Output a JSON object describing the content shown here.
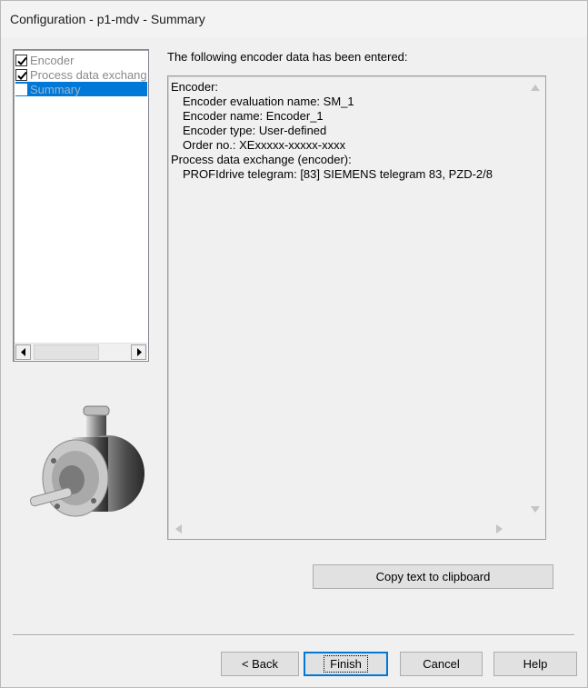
{
  "window": {
    "title": "Configuration - p1-mdv - Summary"
  },
  "tree": {
    "items": [
      {
        "label": "Encoder",
        "checked": true
      },
      {
        "label": "Process data exchange",
        "checked": true
      },
      {
        "label": "Summary",
        "checked": false,
        "selected": true
      }
    ]
  },
  "main": {
    "intro": "The following encoder data has been entered:",
    "summary_lines": [
      {
        "text": "Encoder:",
        "indent": 0
      },
      {
        "text": "Encoder evaluation name: SM_1",
        "indent": 1
      },
      {
        "text": "Encoder name: Encoder_1",
        "indent": 1
      },
      {
        "text": "Encoder type: User-defined",
        "indent": 1
      },
      {
        "text": "Order no.: XExxxxx-xxxxx-xxxx",
        "indent": 1
      },
      {
        "text": "Process data exchange (encoder):",
        "indent": 0
      },
      {
        "text": "PROFIdrive telegram: [83] SIEMENS telegram 83, PZD-2/8",
        "indent": 1
      }
    ],
    "copy_button": "Copy text to clipboard"
  },
  "footer": {
    "back": "< Back",
    "finish": "Finish",
    "cancel": "Cancel",
    "help": "Help"
  },
  "colors": {
    "selection": "#0078d7",
    "button_face": "#e1e1e1",
    "window_bg": "#f0f0f0"
  },
  "icons": [
    "checkbox-checked-icon",
    "scroll-left-arrow-icon",
    "scroll-right-arrow-icon",
    "scroll-up-arrow-icon",
    "scroll-down-arrow-icon"
  ]
}
